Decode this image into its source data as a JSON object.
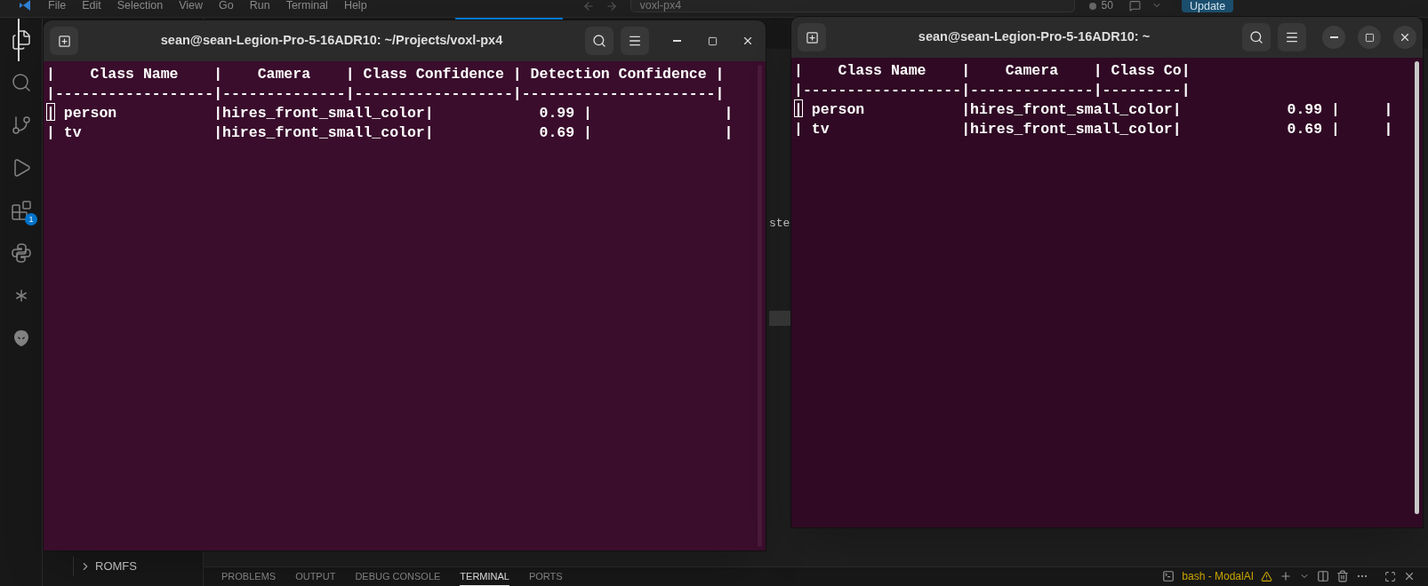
{
  "menu_bar": {
    "items": [
      "File",
      "Edit",
      "Selection",
      "View",
      "Go",
      "Run",
      "Terminal",
      "Help"
    ],
    "search": "voxl-px4",
    "count": "50",
    "update_button": "Update"
  },
  "activity_bar": [
    {
      "kind": "files",
      "selected": true
    },
    {
      "kind": "search",
      "selected": false
    },
    {
      "kind": "source-control",
      "selected": false
    },
    {
      "kind": "run",
      "selected": false
    },
    {
      "kind": "extensions",
      "selected": false,
      "badge": "1"
    },
    {
      "kind": "python",
      "selected": false
    },
    {
      "kind": "burst",
      "selected": false
    },
    {
      "kind": "alien",
      "selected": false
    }
  ],
  "explorer": {
    "items": [
      {
        "label": "ROMFS",
        "expanded": false
      }
    ]
  },
  "editor": {
    "partial_text": "ste"
  },
  "panel": {
    "tabs": [
      {
        "label": "PROBLEMS",
        "selected": false
      },
      {
        "label": "OUTPUT",
        "selected": false
      },
      {
        "label": "DEBUG CONSOLE",
        "selected": false
      },
      {
        "label": "TERMINAL",
        "selected": true
      },
      {
        "label": "PORTS",
        "selected": false
      }
    ],
    "terminal_name": "bash - ModalAI"
  },
  "terminals": [
    {
      "title": "sean@sean-Legion-Pro-5-16ADR10: ~/Projects/voxl-px4",
      "focused": false,
      "lines": [
        {
          "text": "|    Class Name    |    Camera    | Class Confidence | Detection Confidence |",
          "cursor": false
        },
        {
          "text": "|------------------|--------------|------------------|----------------------|",
          "cursor": false
        },
        {
          "text": "| person           |hires_front_small_color|            0.99 |               |",
          "cursor": true
        },
        {
          "text": "| tv               |hires_front_small_color|            0.69 |               |",
          "cursor": false
        }
      ]
    },
    {
      "title": "sean@sean-Legion-Pro-5-16ADR10: ~",
      "focused": true,
      "lines": [
        {
          "text": "|    Class Name    |    Camera    | Class Co|",
          "cursor": false
        },
        {
          "text": "|------------------|--------------|---------|",
          "cursor": false
        },
        {
          "text": "| person           |hires_front_small_color|            0.99 |     |",
          "cursor": true
        },
        {
          "text": "| tv               |hires_front_small_color|            0.69 |     |",
          "cursor": false
        }
      ]
    }
  ]
}
